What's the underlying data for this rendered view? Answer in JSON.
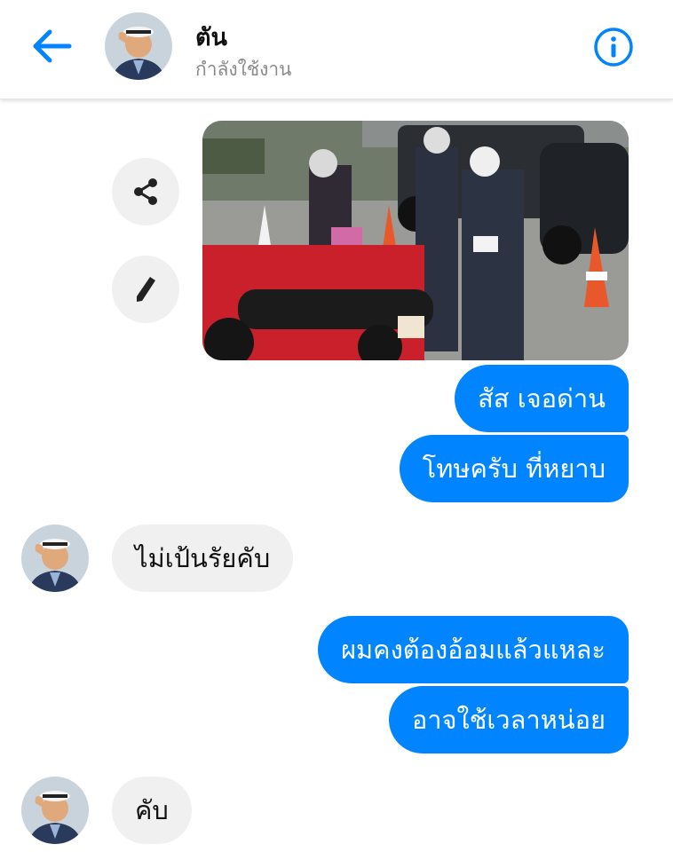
{
  "header": {
    "contact_name": "ตัน",
    "status": "กำลังใช้งาน"
  },
  "messages": [
    {
      "from": "me",
      "kind": "photo"
    },
    {
      "from": "me",
      "text": "สัส เจอด่าน"
    },
    {
      "from": "me",
      "text": "โทษครับ ที่หยาบ"
    },
    {
      "from": "contact",
      "text": "ไม่เป้นรัยคับ"
    },
    {
      "from": "me",
      "text": "ผมคงต้องอ้อมแล้วแหละ"
    },
    {
      "from": "me",
      "text": "อาจใช้เวลาหน่อย"
    },
    {
      "from": "contact",
      "text": "คับ"
    }
  ],
  "icons": {
    "back": "arrow-left-icon",
    "info": "info-icon",
    "share": "share-icon",
    "edit": "pencil-icon"
  },
  "colors": {
    "accent": "#0084ff",
    "incoming_bubble": "#f0f0f0",
    "status_text": "#8a8a8a"
  }
}
